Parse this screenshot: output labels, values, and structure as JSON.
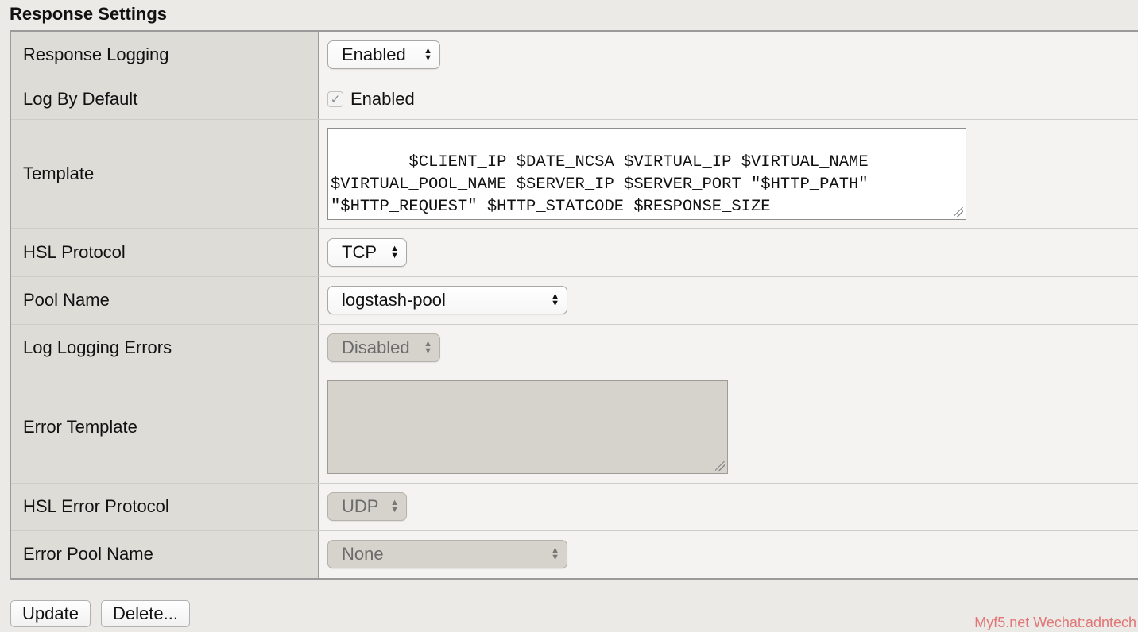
{
  "section": {
    "title": "Response Settings"
  },
  "rows": {
    "response_logging": {
      "label": "Response Logging",
      "value": "Enabled"
    },
    "log_by_default": {
      "label": "Log By Default",
      "checkbox_label": "Enabled",
      "checked": true
    },
    "template": {
      "label": "Template",
      "value": "$CLIENT_IP $DATE_NCSA $VIRTUAL_IP $VIRTUAL_NAME\n$VIRTUAL_POOL_NAME $SERVER_IP $SERVER_PORT \"$HTTP_PATH\"\n\"$HTTP_REQUEST\" $HTTP_STATCODE $RESPONSE_SIZE\n$RESPONSE_MSECS \"$Referer\" \"${User-agent}\""
    },
    "hsl_protocol": {
      "label": "HSL Protocol",
      "value": "TCP"
    },
    "pool_name": {
      "label": "Pool Name",
      "value": "logstash-pool"
    },
    "log_logging_errors": {
      "label": "Log Logging Errors",
      "value": "Disabled",
      "disabled": true
    },
    "error_template": {
      "label": "Error Template",
      "value": "",
      "disabled": true
    },
    "hsl_error_protocol": {
      "label": "HSL Error Protocol",
      "value": "UDP",
      "disabled": true
    },
    "error_pool_name": {
      "label": "Error Pool Name",
      "value": "None",
      "disabled": true
    }
  },
  "buttons": {
    "update": "Update",
    "delete": "Delete..."
  },
  "watermark": "Myf5.net Wechat:adntech",
  "colors": {
    "label_bg": "#dedcd7",
    "value_bg": "#f4f3f1",
    "disabled_bg": "#d6d2cc",
    "watermark": "#e07676"
  },
  "icons": {
    "select_arrows": "up-down-arrows-icon",
    "checkmark": "checkmark-icon",
    "resize": "resize-grip-icon"
  }
}
